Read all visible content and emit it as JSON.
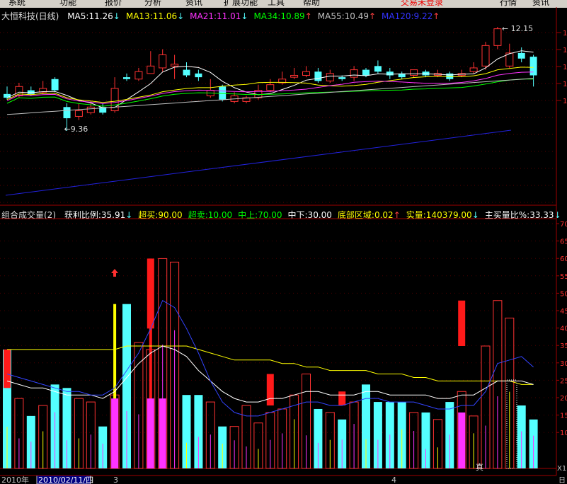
{
  "menu": {
    "items": [
      "系统",
      "功能",
      "报价",
      "分析",
      "资讯",
      "扩展功能",
      "工具",
      "帮助"
    ],
    "status": "交易未登录",
    "right_buttons": [
      "行情",
      "资讯"
    ]
  },
  "main": {
    "title": "大恒科技(日线)",
    "ma": [
      {
        "label": "MA5:11.26",
        "arrow": "↓",
        "color": "#ffffff"
      },
      {
        "label": "MA13:11.06",
        "arrow": "↓",
        "color": "#ffff00"
      },
      {
        "label": "MA21:11.01",
        "arrow": "↓",
        "color": "#ff33ff"
      },
      {
        "label": "MA34:10.89",
        "arrow": "↑",
        "color": "#00ff00"
      },
      {
        "label": "MA55:10.49",
        "arrow": "↑",
        "color": "#c0c0c0"
      },
      {
        "label": "MA120:9.22",
        "arrow": "↑",
        "color": "#3333ff"
      }
    ],
    "high_label": "12.15",
    "low_label": "9.36"
  },
  "sub": {
    "title": "组合成交量(2)",
    "items": [
      {
        "label": "获利比例:35.91",
        "arrow": "↓",
        "color": "#ffffff"
      },
      {
        "label": "超买:90.00",
        "arrow": "",
        "color": "#ffff00"
      },
      {
        "label": "超卖:10.00",
        "arrow": "",
        "color": "#00ff00"
      },
      {
        "label": "中上:70.00",
        "arrow": "",
        "color": "#00ff00"
      },
      {
        "label": "中下:30.00",
        "arrow": "",
        "color": "#ffffff"
      },
      {
        "label": "底部区域:0.02",
        "arrow": "↑",
        "color": "#ffff00"
      },
      {
        "label": "实量:140379.00",
        "arrow": "↓",
        "color": "#ffff00"
      },
      {
        "label": "主买量比%:33.33",
        "arrow": "↓",
        "color": "#ffffff"
      }
    ],
    "axis_ticks": [
      "70",
      "65",
      "60",
      "55",
      "50",
      "45",
      "40",
      "35",
      "30",
      "25",
      "20",
      "15",
      "10"
    ],
    "marker": "真"
  },
  "bottom": {
    "year": "2010年",
    "date": "2010/02/11/四",
    "month_marks": [
      "3",
      "4"
    ],
    "corner": "X1",
    "corner2": "日"
  },
  "colors": {
    "up": "#ff3232",
    "down": "#54ffff",
    "ma5": "#ffffff",
    "ma13": "#ffff00",
    "ma21": "#ff33ff",
    "ma34": "#00ff00",
    "ma120": "#2222dd",
    "grid": "#a00000"
  }
}
